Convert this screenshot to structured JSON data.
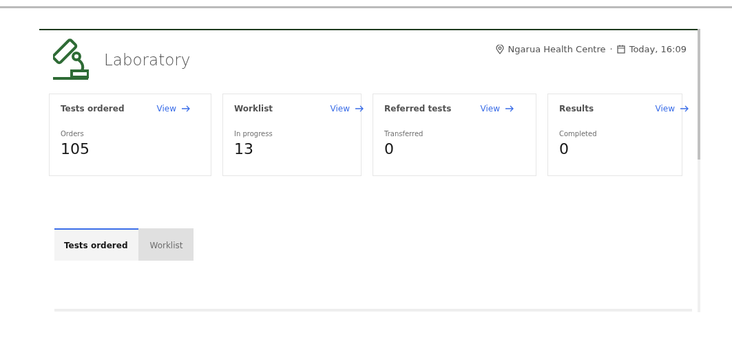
{
  "header": {
    "title": "Laboratory",
    "location": "Ngarua Health Centre",
    "separator": "·",
    "date": "Today, 16:09"
  },
  "cards": [
    {
      "title": "Tests ordered",
      "link": "View",
      "label": "Orders",
      "value": "105"
    },
    {
      "title": "Worklist",
      "link": "View",
      "label": "In progress",
      "value": "13"
    },
    {
      "title": "Referred tests",
      "link": "View",
      "label": "Transferred",
      "value": "0"
    },
    {
      "title": "Results",
      "link": "View",
      "label": "Completed",
      "value": "0"
    }
  ],
  "tabs": [
    {
      "label": "Tests ordered",
      "selected": true
    },
    {
      "label": "Worklist",
      "selected": false
    }
  ]
}
